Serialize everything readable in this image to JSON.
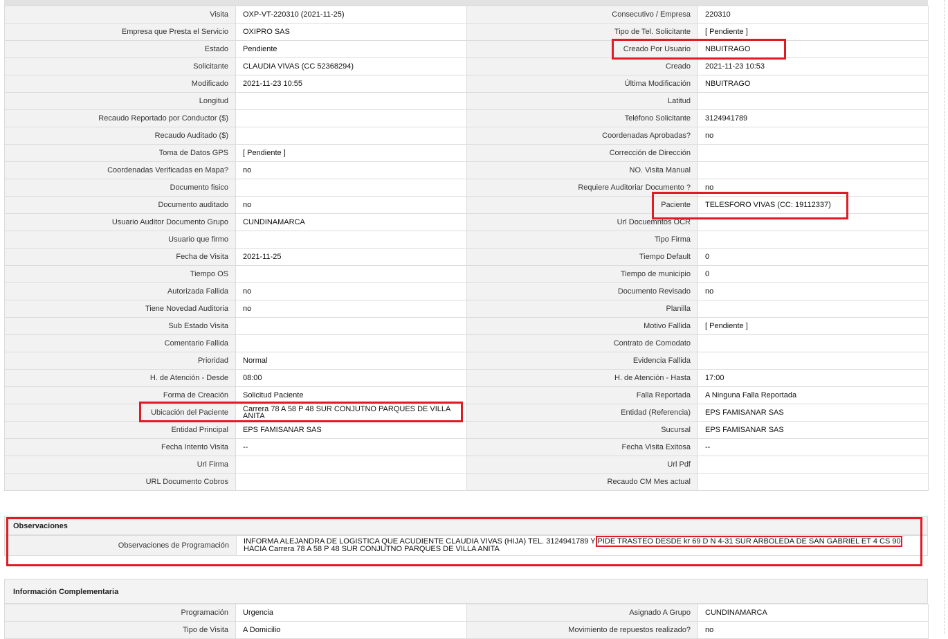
{
  "main_rows": [
    {
      "l1": "Visita",
      "v1": "OXP-VT-220310 (2021-11-25)",
      "l2": "Consecutivo / Empresa",
      "v2": "220310"
    },
    {
      "l1": "Empresa que Presta el Servicio",
      "v1": "OXIPRO SAS",
      "l2": "Tipo de Tel. Solicitante",
      "v2": "[ Pendiente ]"
    },
    {
      "l1": "Estado",
      "v1": "Pendiente",
      "l2": "Creado Por Usuario",
      "v2": "NBUITRAGO"
    },
    {
      "l1": "Solicitante",
      "v1": "CLAUDIA VIVAS (CC 52368294)",
      "l2": "Creado",
      "v2": "2021-11-23 10:53"
    },
    {
      "l1": "Modificado",
      "v1": "2021-11-23 10:55",
      "l2": "Última Modificación",
      "v2": " NBUITRAGO"
    },
    {
      "l1": "Longitud",
      "v1": "",
      "l2": "Latitud",
      "v2": ""
    },
    {
      "l1": "Recaudo Reportado por Conductor ($)",
      "v1": "",
      "l2": "Teléfono Solicitante",
      "v2": "3124941789"
    },
    {
      "l1": "Recaudo Auditado ($)",
      "v1": "",
      "l2": "Coordenadas Aprobadas?",
      "v2": " no"
    },
    {
      "l1": "Toma de Datos GPS",
      "v1": "[ Pendiente ]",
      "l2": "Corrección de Dirección",
      "v2": ""
    },
    {
      "l1": "Coordenadas Verificadas en Mapa?",
      "v1": " no",
      "l2": "NO. Visita Manual",
      "v2": ""
    },
    {
      "l1": "Documento fisico",
      "v1": "",
      "l2": "Requiere Auditoriar Documento ?",
      "v2": " no"
    },
    {
      "l1": "Documento auditado",
      "v1": " no",
      "l2": "Paciente",
      "v2": "TELESFORO VIVAS (CC: 19112337)"
    },
    {
      "l1": "Usuario Auditor Documento Grupo",
      "v1": "CUNDINAMARCA",
      "l2": "Url Docuemntos OCR",
      "v2": ""
    },
    {
      "l1": "Usuario que firmo",
      "v1": "",
      "l2": "Tipo Firma",
      "v2": ""
    },
    {
      "l1": "Fecha de Visita",
      "v1": " 2021-11-25",
      "l2": "Tiempo Default",
      "v2": "0"
    },
    {
      "l1": "Tiempo OS",
      "v1": "",
      "l2": "Tiempo de municipio",
      "v2": "0"
    },
    {
      "l1": "Autorizada Fallida",
      "v1": " no",
      "l2": "Documento Revisado",
      "v2": " no"
    },
    {
      "l1": "Tiene Novedad Auditoria",
      "v1": " no",
      "l2": "Planilla",
      "v2": ""
    },
    {
      "l1": "Sub Estado Visita",
      "v1": "",
      "l2": "Motivo Fallida",
      "v2": "[ Pendiente ]"
    },
    {
      "l1": "Comentario Fallida",
      "v1": "",
      "l2": "Contrato de Comodato",
      "v2": ""
    },
    {
      "l1": "Prioridad",
      "v1": "Normal",
      "l2": "Evidencia Fallida",
      "v2": ""
    },
    {
      "l1": "H. de Atención - Desde",
      "v1": "08:00",
      "l2": "H. de Atención - Hasta",
      "v2": "17:00"
    },
    {
      "l1": "Forma de Creación",
      "v1": "Solicitud Paciente",
      "l2": "Falla Reportada",
      "v2": "A Ninguna Falla Reportada"
    },
    {
      "l1": "Ubicación del Paciente",
      "v1": "Carrera 78 A 58 P 48 SUR CONJUTNO PARQUES DE VILLA ANITA",
      "l2": "Entidad (Referencia)",
      "v2": "EPS FAMISANAR SAS"
    },
    {
      "l1": "Entidad Principal",
      "v1": "EPS FAMISANAR SAS",
      "l2": "Sucursal",
      "v2": "EPS FAMISANAR SAS"
    },
    {
      "l1": "Fecha Intento Visita",
      "v1": " --",
      "l2": "Fecha Visita Exitosa",
      "v2": " --"
    },
    {
      "l1": "Url Firma",
      "v1": "",
      "l2": "Url Pdf",
      "v2": ""
    },
    {
      "l1": "URL Documento Cobros",
      "v1": "",
      "l2": "Recaudo CM Mes actual",
      "v2": ""
    }
  ],
  "observaciones": {
    "title": "Observaciones",
    "label": "Observaciones de Programación",
    "text_part1": "  INFORMA ALEJANDRA DE LOGISTICA QUE ACUDIENTE CLAUDIA VIVAS (HIJA) TEL. 3124941789 Y ",
    "text_highlight": "PIDE TRASTEO DESDE kr 69 D N 4-31 SUR ARBOLEDA DE SAN GABRIEL ET 4 CS 90",
    "text_part2": " HACIA Carrera 78 A 58 P 48 SUR CONJUTNO PARQUES DE VILLA ANITA"
  },
  "complementaria": {
    "title": "Información Complementaria",
    "rows": [
      {
        "l1": "Programación",
        "v1": "Urgencia",
        "l2": "Asignado A Grupo",
        "v2": "CUNDINAMARCA"
      },
      {
        "l1": "Tipo de Visita",
        "v1": "A Domicilio",
        "l2": "Movimiento de repuestos realizado?",
        "v2": " no"
      }
    ]
  },
  "colors": {
    "highlight": "#e01b24",
    "label_bg": "#f2f2f2",
    "border": "#dcdcdc"
  }
}
